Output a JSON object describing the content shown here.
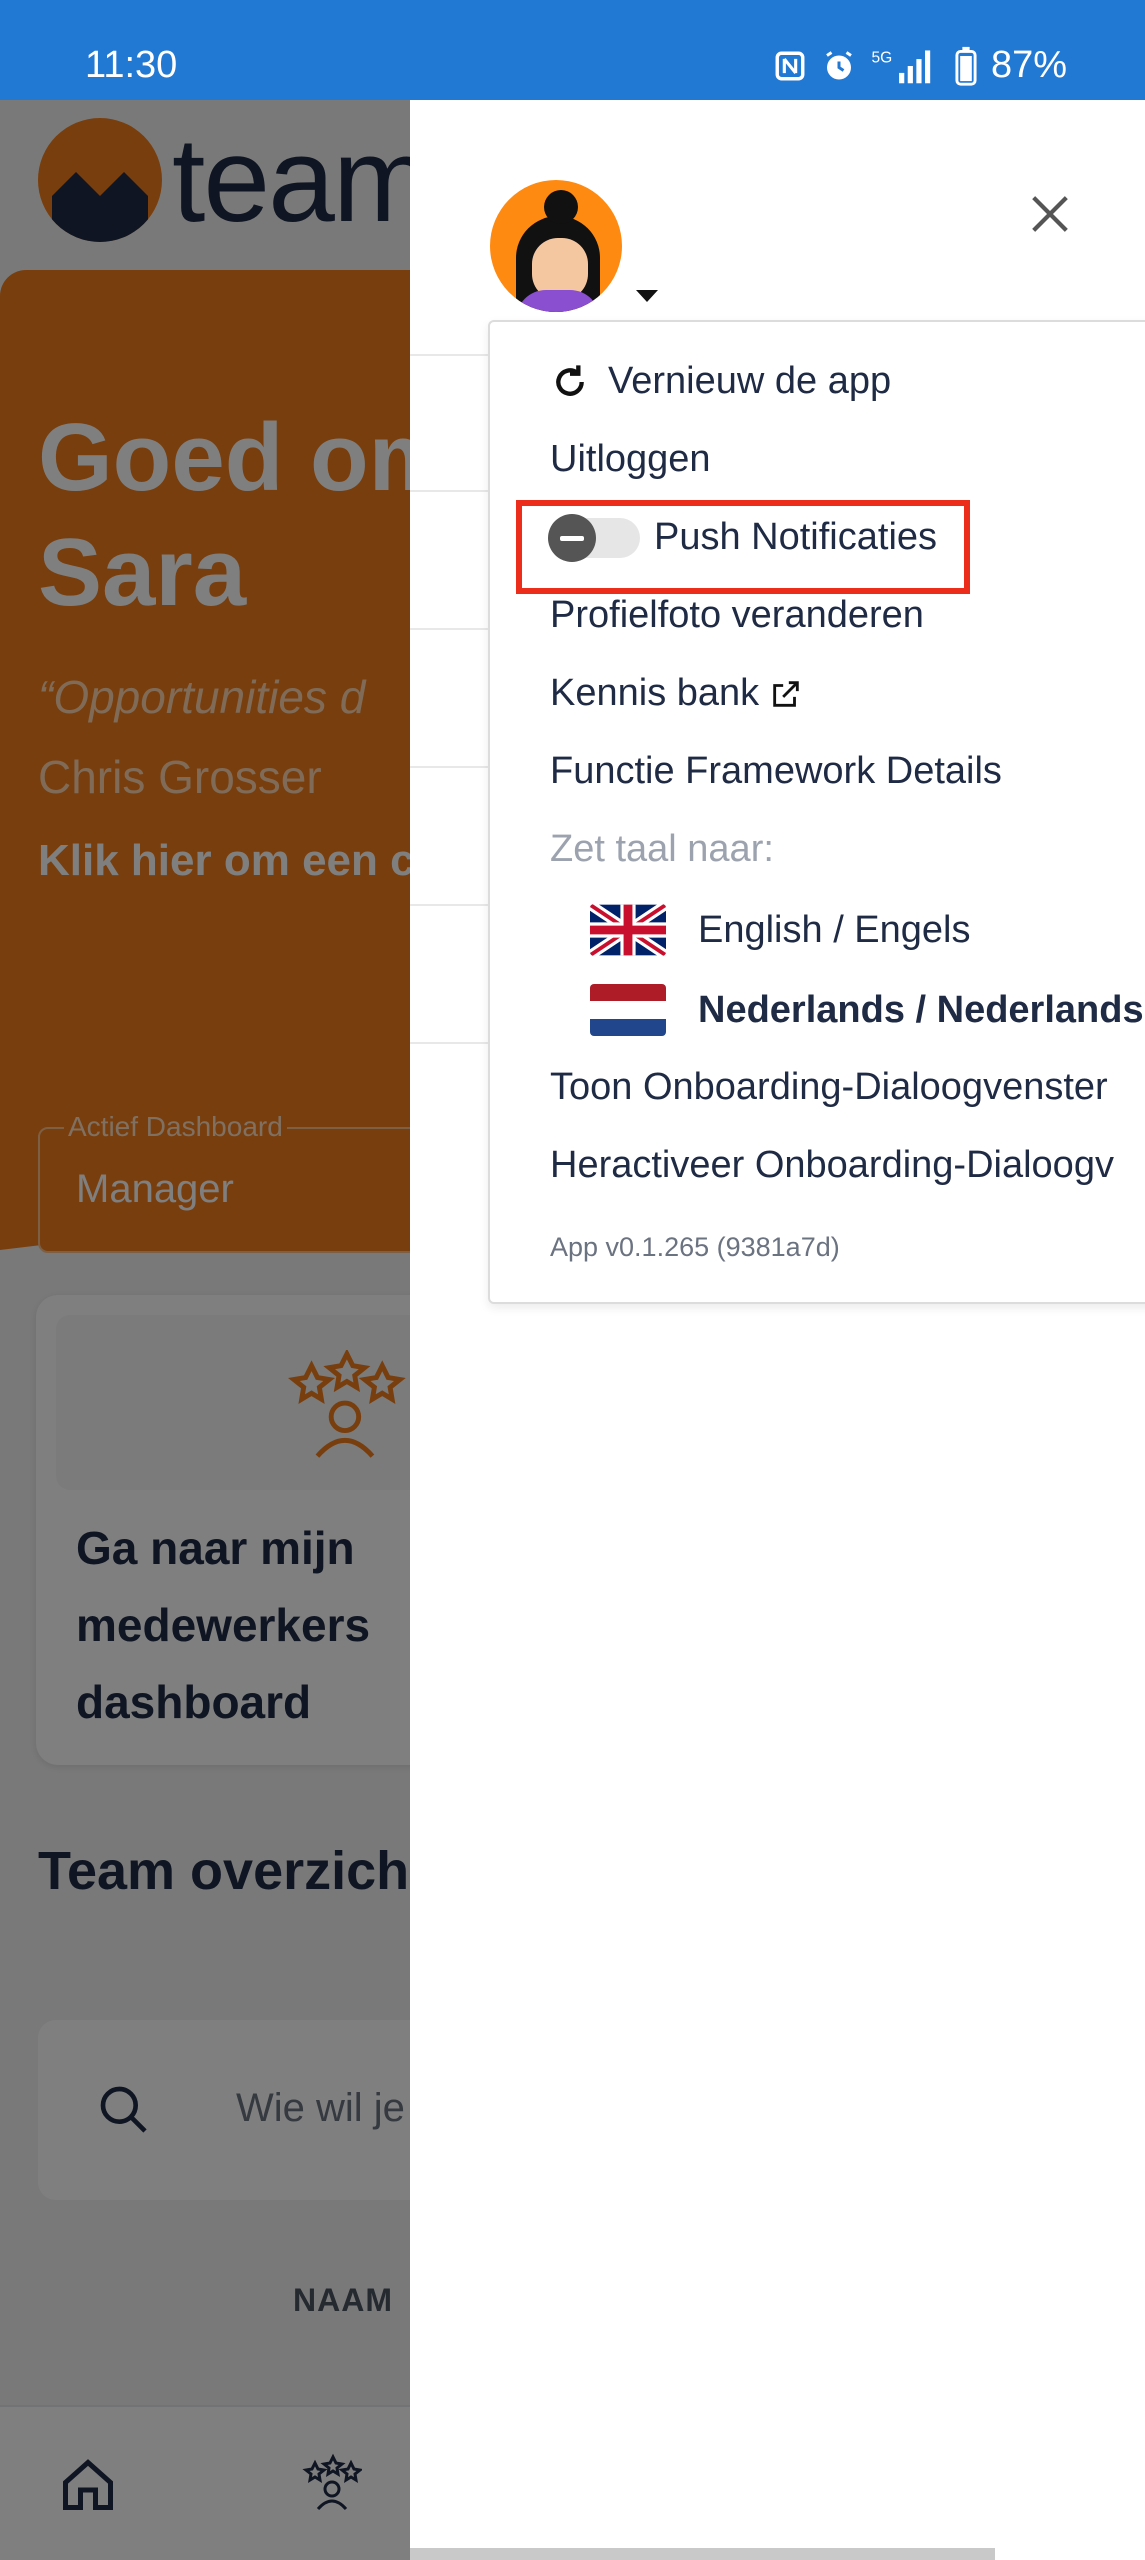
{
  "status_bar": {
    "time": "11:30",
    "battery": "87%",
    "icons": [
      "nfc-icon",
      "alarm-icon",
      "5g-signal-icon",
      "battery-icon"
    ]
  },
  "background": {
    "logo_text": "team",
    "greeting": "Goed om\nSara",
    "quote": "“Opportunities d",
    "author": "Chris Grosser",
    "cta": "Klik hier om een c collega. >",
    "dashboard_select": {
      "label": "Actief Dashboard",
      "value": "Manager"
    },
    "card_title": "Ga naar mijn medewerkers dashboard",
    "team_title": "Team overzich",
    "search_placeholder": "Wie wil je",
    "column_naam": "NAAM"
  },
  "drawer": {
    "menu": {
      "refresh": "Vernieuw de app",
      "logout": "Uitloggen",
      "push": "Push Notificaties",
      "profile_photo": "Profielfoto veranderen",
      "knowledge": "Kennis bank",
      "framework": "Functie Framework Details",
      "language_header": "Zet taal naar:",
      "lang_en": "English / Engels",
      "lang_nl": "Nederlands / Nederlands",
      "onboarding_show": "Toon Onboarding-Dialoogvenster",
      "onboarding_reactivate": "Heractiveer Onboarding-Dialoogv",
      "version": "App v0.1.265 (9381a7d)"
    },
    "push_enabled": false
  },
  "colors": {
    "status_bar": "#2179d4",
    "brand_orange": "#f07d1a",
    "navy": "#1f2a44",
    "highlight": "#ec2d1b"
  }
}
